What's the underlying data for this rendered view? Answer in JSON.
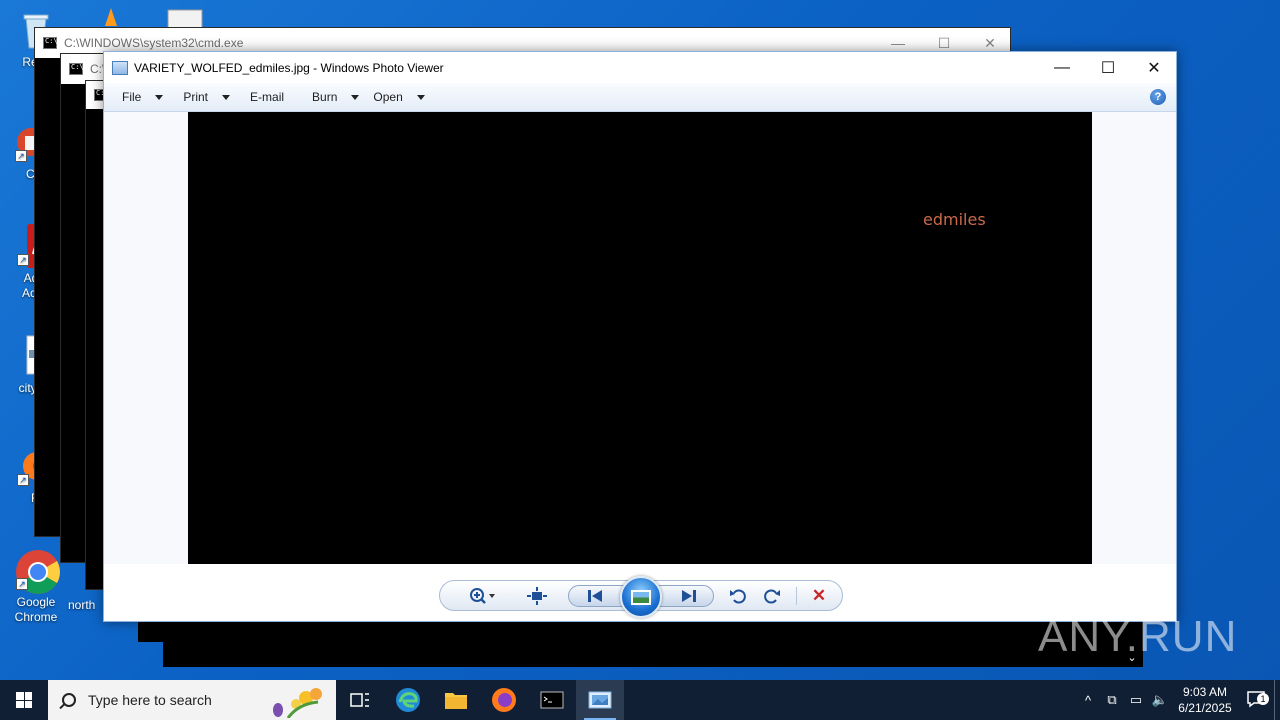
{
  "desktop": {
    "icons": [
      {
        "label": "Recy",
        "icon": "recycle-bin-icon"
      },
      {
        "label": "CCl",
        "icon": "ccleaner-icon"
      },
      {
        "label": "Ad Acr",
        "icon": "adobe-acrobat-icon"
      },
      {
        "label": "cityvi",
        "icon": "image-file-icon"
      },
      {
        "label": "Fir",
        "icon": "firefox-icon"
      },
      {
        "label": "Google Chrome",
        "icon": "chrome-icon"
      },
      {
        "label": "north",
        "icon": "file-icon"
      }
    ]
  },
  "cmd_windows": [
    {
      "title": "C:\\WINDOWS\\system32\\cmd.exe"
    },
    {
      "title": "C:\\"
    }
  ],
  "photo_viewer": {
    "title": "VARIETY_WOLFED_edmiles.jpg - Windows Photo Viewer",
    "menu": [
      "File",
      "Print",
      "E-mail",
      "Burn",
      "Open"
    ],
    "help_label": "?",
    "image_text": "edmiles",
    "image_text_color": "#c96a4a"
  },
  "watermark": "ANY.RUN",
  "taskbar": {
    "search_placeholder": "Type here to search",
    "time": "9:03 AM",
    "date": "6/21/2025",
    "notification_count": "1"
  }
}
